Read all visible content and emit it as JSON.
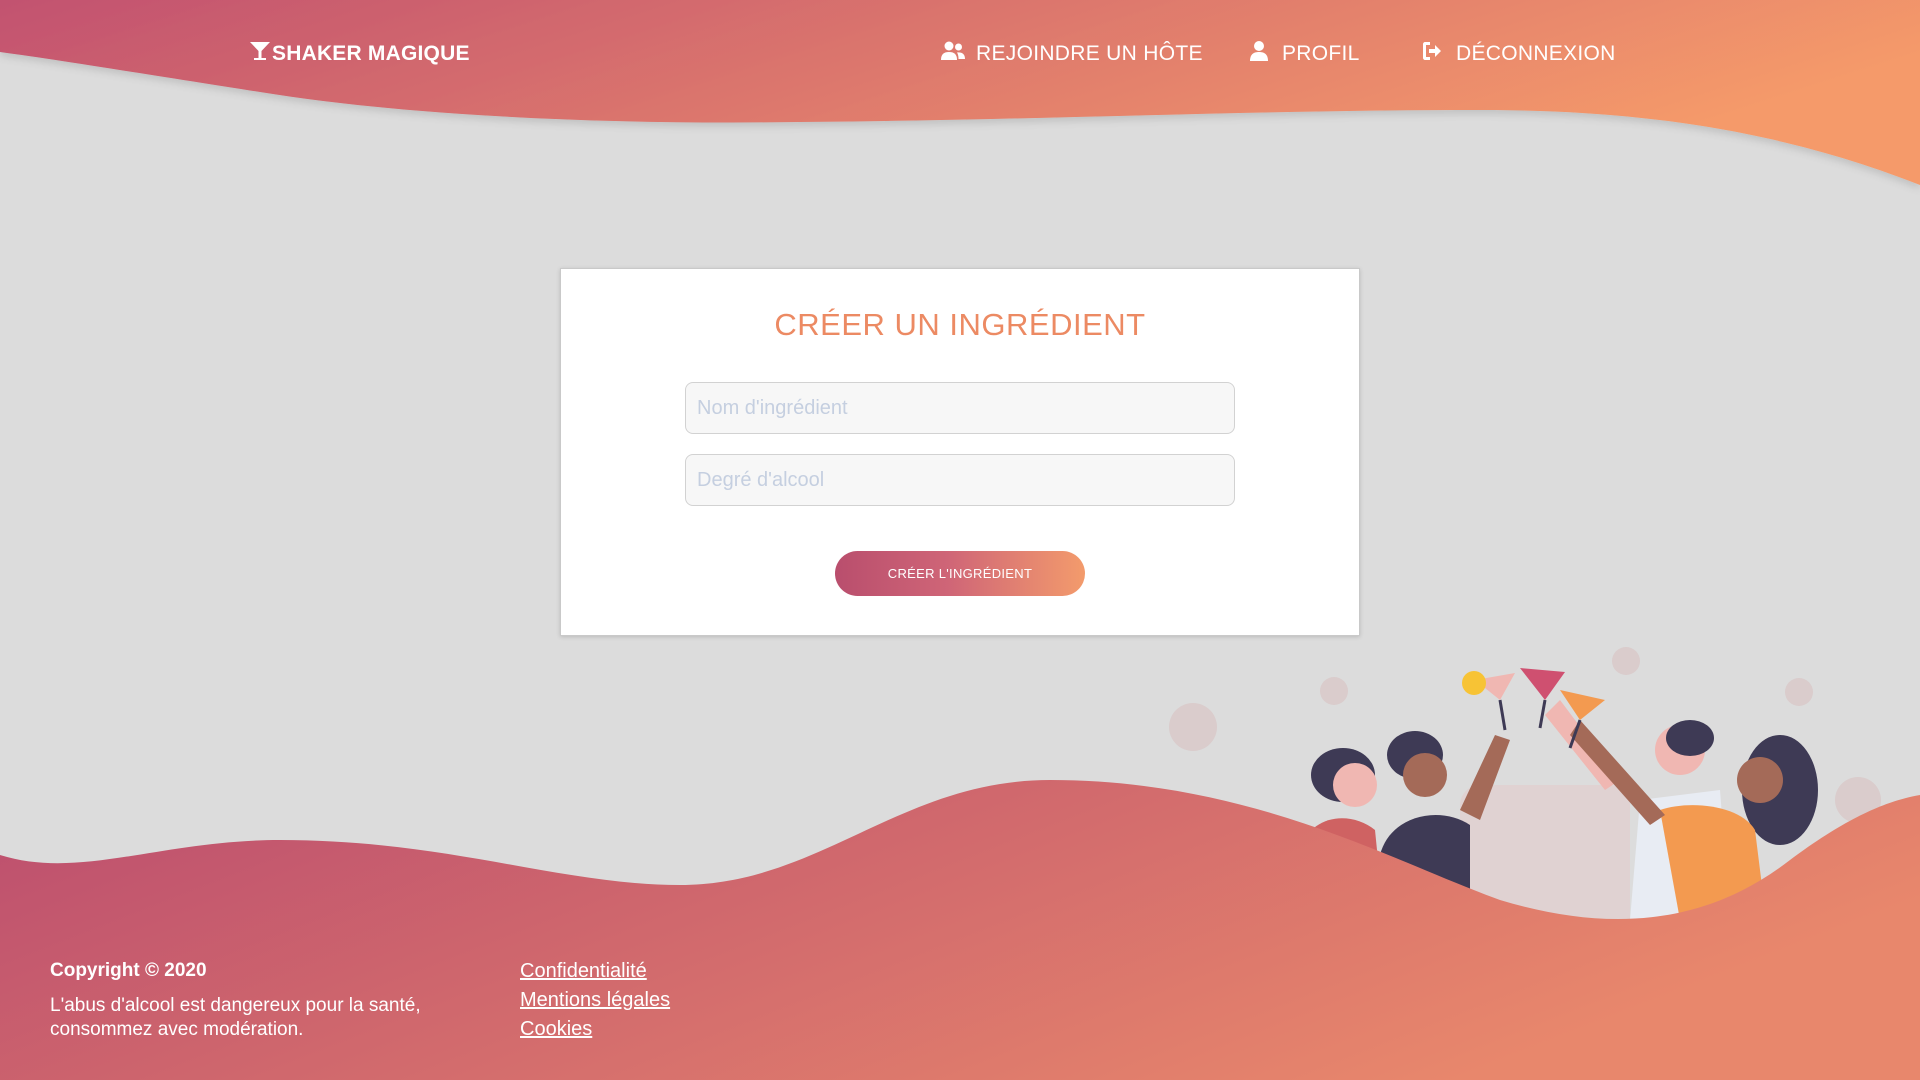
{
  "nav": {
    "brand": "SHAKER MAGIQUE",
    "join_host": "REJOINDRE UN HÔTE",
    "profile": "PROFIL",
    "logout": "DÉCONNEXION"
  },
  "form": {
    "title": "CRÉER UN INGRÉDIENT",
    "name_placeholder": "Nom d'ingrédient",
    "alcohol_placeholder": "Degré d'alcool",
    "submit_label": "CRÉER L'INGRÉDIENT"
  },
  "footer": {
    "copyright": "Copyright © 2020",
    "warning_line1": "L'abus d'alcool est dangereux pour la santé,",
    "warning_line2": "consommez avec modération.",
    "links": [
      "Confidentialité",
      "Mentions légales",
      "Cookies"
    ]
  },
  "colors": {
    "gradient_start": "#c2526f",
    "gradient_end": "#f59a6b",
    "title_color": "#ec8a63",
    "background": "#dcdcdc"
  },
  "icons": {
    "brand": "cocktail-glass-icon",
    "join_host": "users-icon",
    "profile": "user-icon",
    "logout": "sign-out-icon"
  }
}
